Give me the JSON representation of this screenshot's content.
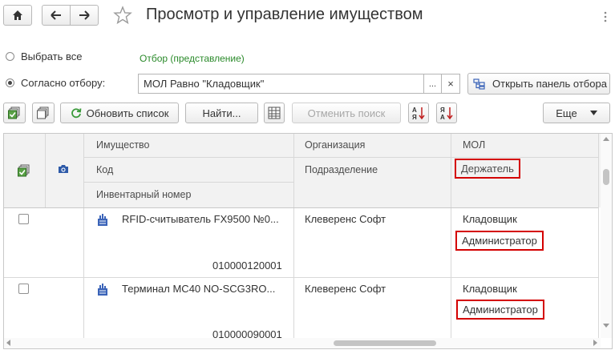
{
  "window": {
    "title": "Просмотр и управление имуществом"
  },
  "filter": {
    "select_all_label": "Выбрать все",
    "by_filter_label": "Согласно отбору:",
    "filter_view_link": "Отбор (представление)",
    "filter_value": "МОЛ Равно \"Кладовщик\"",
    "ellipsis_label": "...",
    "clear_label": "×",
    "open_panel_label": "Открыть панель отбора"
  },
  "toolbar": {
    "refresh_label": "Обновить список",
    "find_label": "Найти...",
    "cancel_search_label": "Отменить поиск",
    "more_label": "Еще"
  },
  "table": {
    "headers": {
      "property": "Имущество",
      "code": "Код",
      "inventory_number": "Инвентарный номер",
      "organization": "Организация",
      "department": "Подразделение",
      "mol": "МОЛ",
      "holder": "Держатель"
    },
    "rows": [
      {
        "name": "RFID-считыватель FX9500 №0...",
        "inventory_number": "010000120001",
        "organization": "Клеверенс Софт",
        "mol": "Кладовщик",
        "holder": "Администратор"
      },
      {
        "name": "Терминал MC40 NO-SCG3RO...",
        "inventory_number": "010000090001",
        "organization": "Клеверенс Софт",
        "mol": "Кладовщик",
        "holder": "Администратор"
      }
    ]
  },
  "colors": {
    "link_green": "#2a8a2a",
    "highlight_red": "#d40000",
    "header_bg": "#f2f2f2",
    "icon_blue": "#3a63b8"
  }
}
